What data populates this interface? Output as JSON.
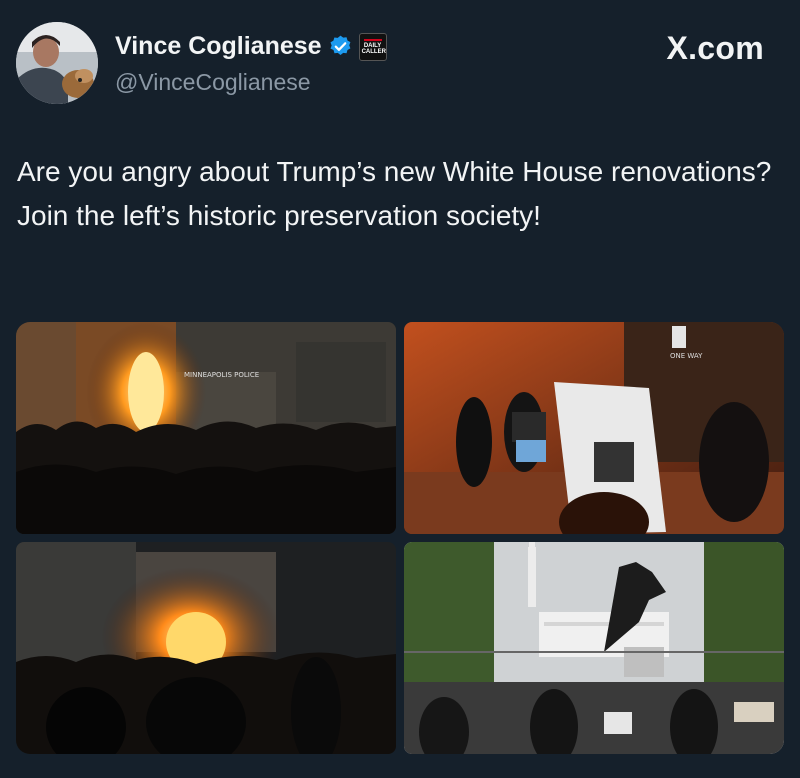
{
  "header": {
    "display_name": "Vince Coglianese",
    "handle": "@VinceCoglianese",
    "verified_icon": "verified-badge-icon",
    "affiliate_badge_text": "DAILY CALLER",
    "brand": "X.com"
  },
  "tweet": {
    "text": "Are you angry about Trump’s new White House renovations? Join the left’s historic preservation society!"
  },
  "photos": [
    {
      "sign": "MINNEAPOLIS POLICE"
    },
    {
      "sign": "ONE WAY"
    },
    {
      "sign": ""
    },
    {
      "sign": ""
    }
  ],
  "colors": {
    "background": "#15202b",
    "verified": "#1d9bf0",
    "secondary_text": "#8b98a5"
  }
}
